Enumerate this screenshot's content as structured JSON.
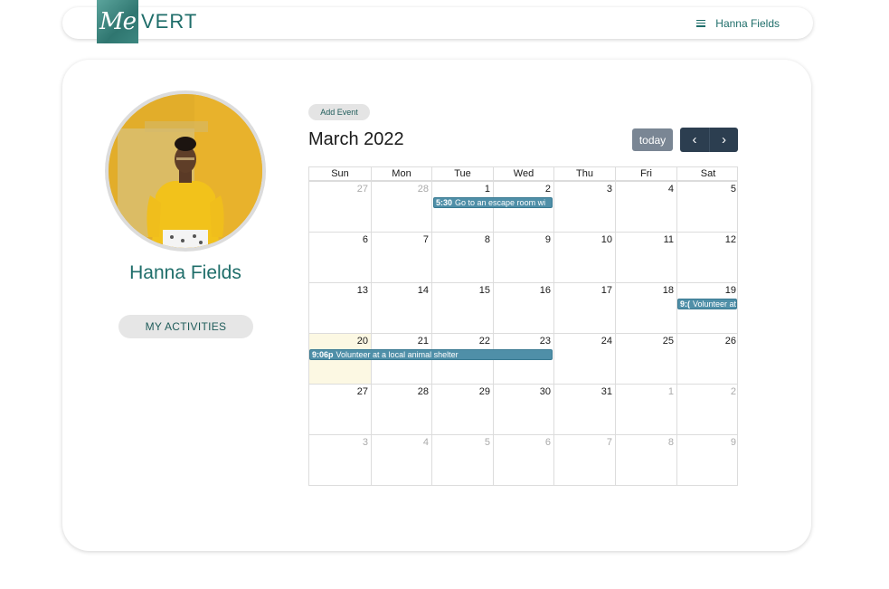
{
  "header": {
    "logo_script": "Me",
    "logo_text": "VERT",
    "user_name": "Hanna Fields"
  },
  "profile": {
    "name": "Hanna Fields",
    "activities_label": "MY ACTIVITIES"
  },
  "calendar": {
    "add_event_label": "Add Event",
    "title": "March 2022",
    "today_label": "today",
    "prev_icon": "‹",
    "next_icon": "›",
    "weekdays": [
      "Sun",
      "Mon",
      "Tue",
      "Wed",
      "Thu",
      "Fri",
      "Sat"
    ],
    "weeks": [
      [
        "27",
        "28",
        "1",
        "2",
        "3",
        "4",
        "5"
      ],
      [
        "6",
        "7",
        "8",
        "9",
        "10",
        "11",
        "12"
      ],
      [
        "13",
        "14",
        "15",
        "16",
        "17",
        "18",
        "19"
      ],
      [
        "20",
        "21",
        "22",
        "23",
        "24",
        "25",
        "26"
      ],
      [
        "27",
        "28",
        "29",
        "30",
        "31",
        "1",
        "2"
      ],
      [
        "3",
        "4",
        "5",
        "6",
        "7",
        "8",
        "9"
      ]
    ],
    "events": [
      {
        "time": "5:30",
        "title": "Go to an escape room wi"
      },
      {
        "time": "9:(",
        "title": "Volunteer at"
      },
      {
        "time": "9:06p",
        "title": "Volunteer at a local animal shelter"
      }
    ]
  },
  "colors": {
    "brand": "#1f6e6a",
    "event": "#4f8fa8",
    "nav_button": "#2c3e50",
    "today_button": "#7a8694",
    "today_highlight": "#fcf8e3"
  }
}
